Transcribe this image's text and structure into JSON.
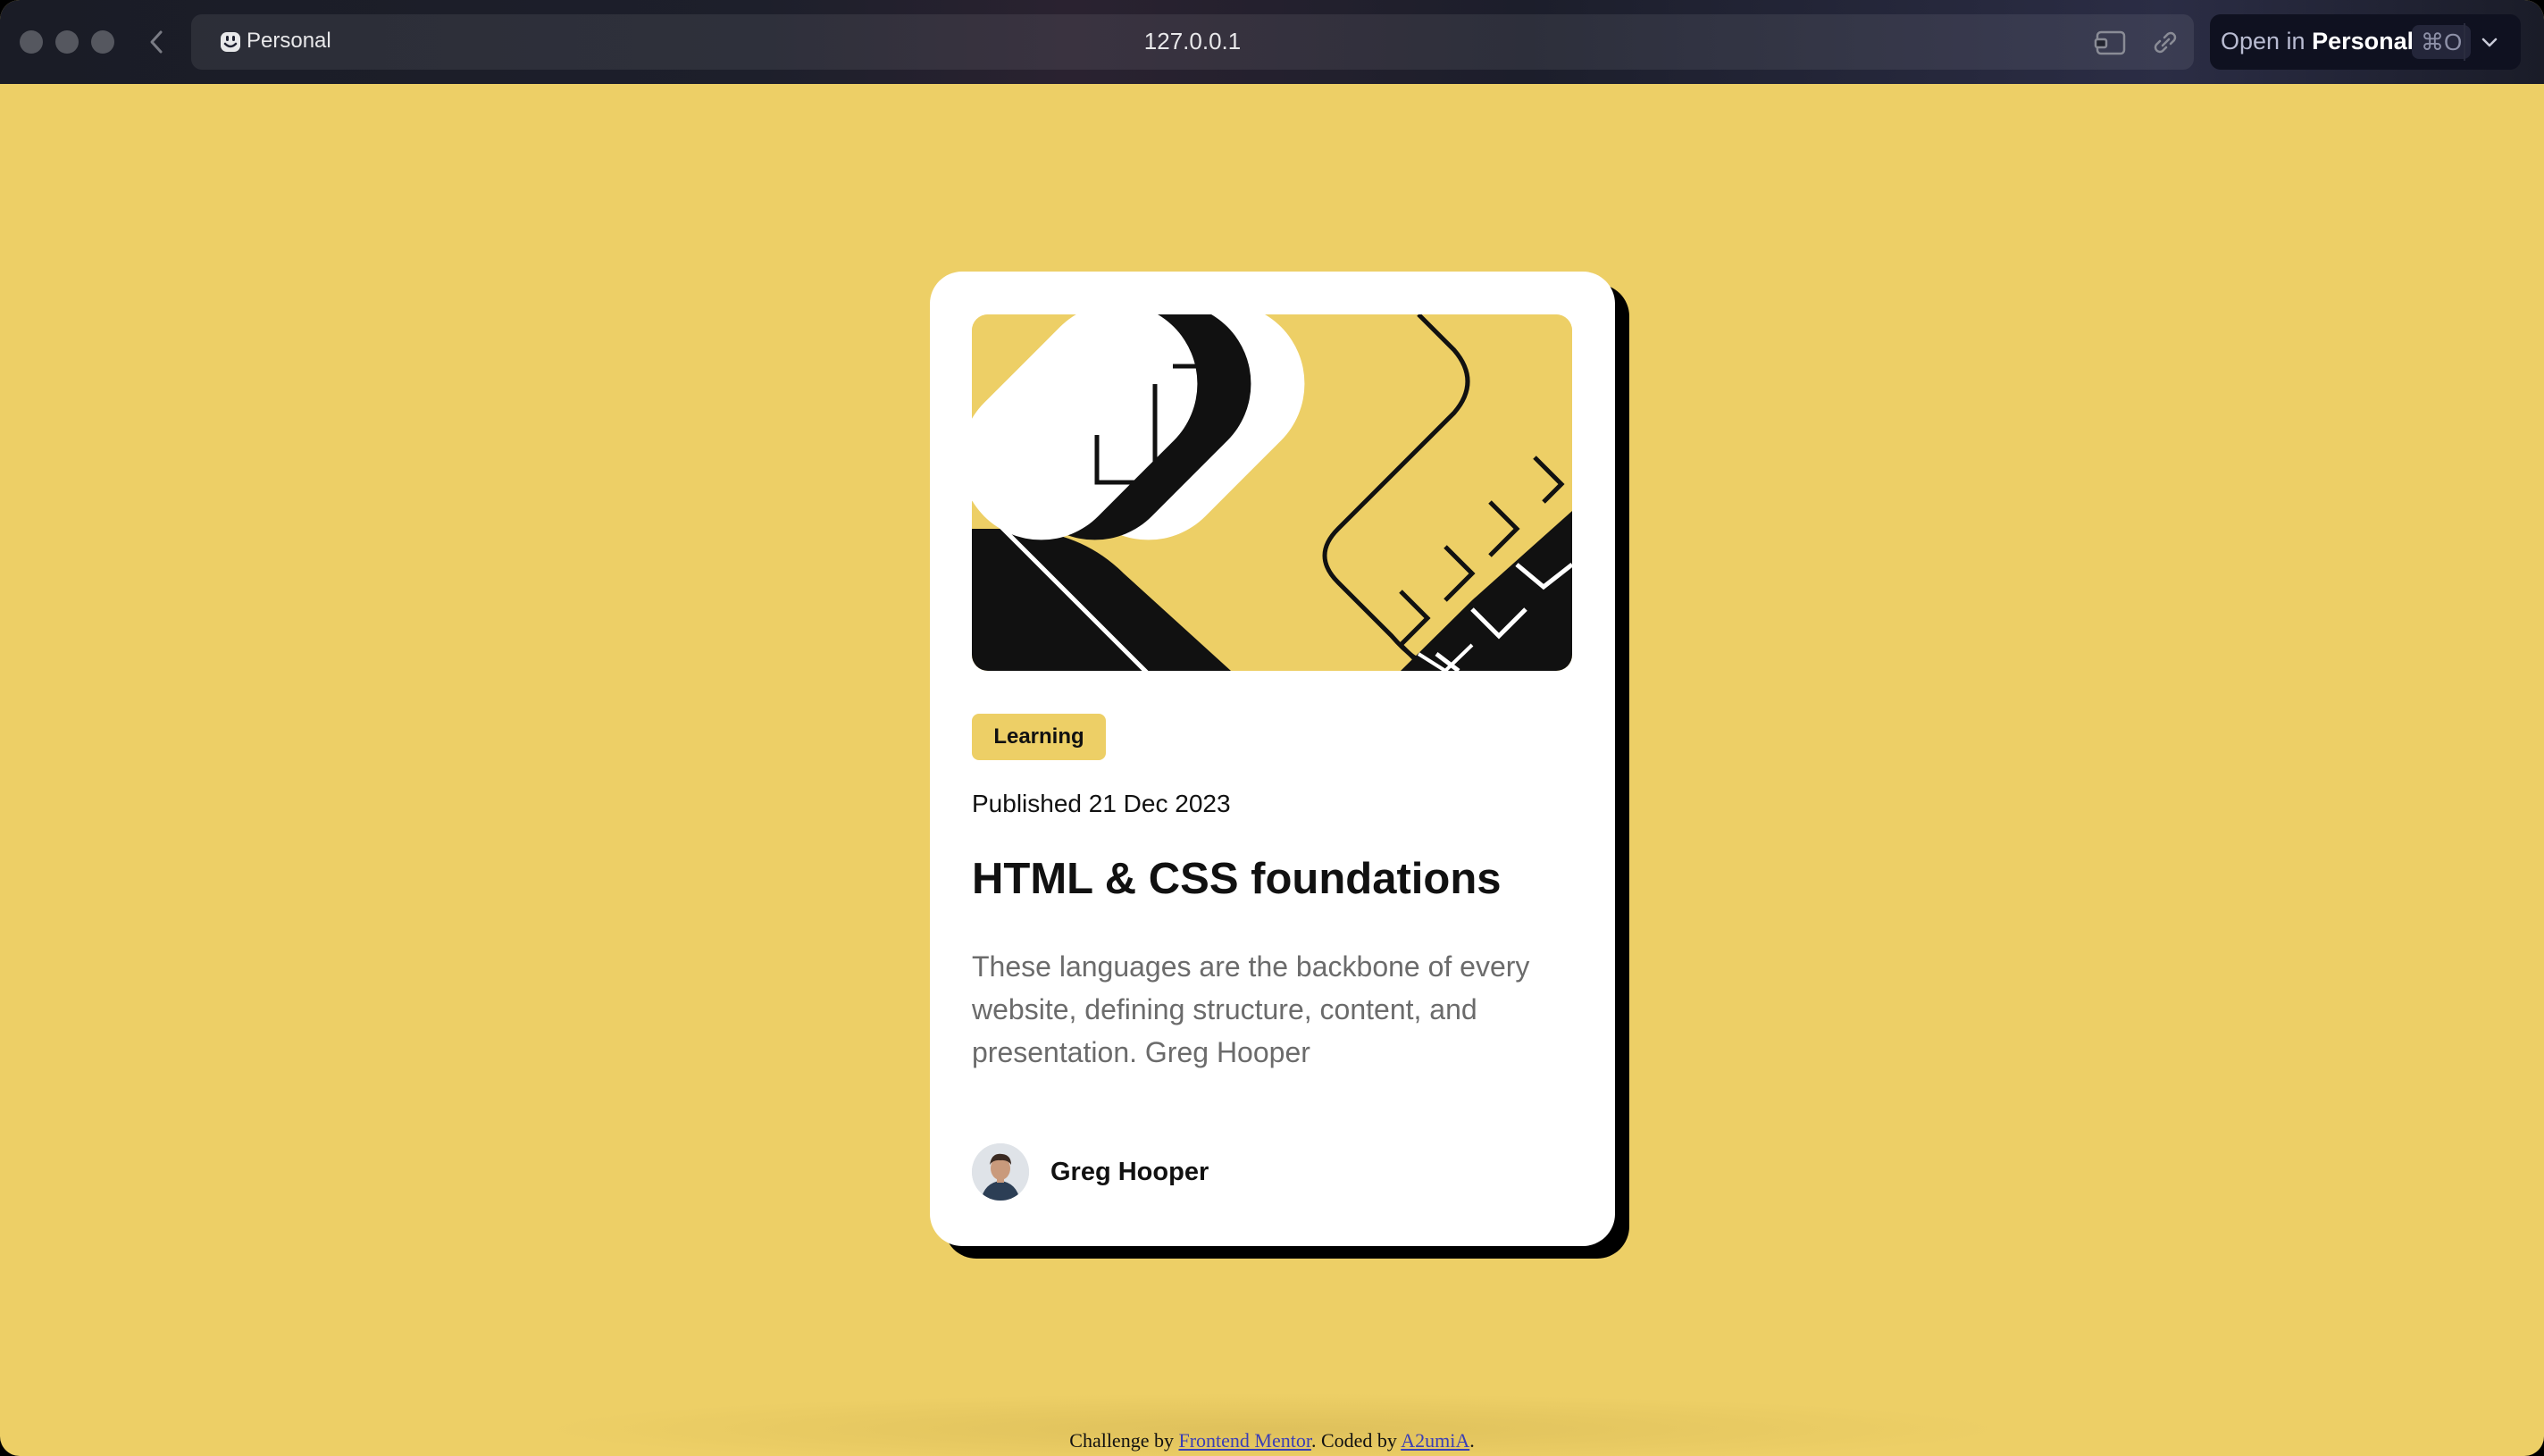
{
  "browser": {
    "profile_label": "Personal",
    "url": "127.0.0.1",
    "open_in_prefix": "Open in",
    "open_in_profile": "Personal",
    "open_shortcut": "⌘O"
  },
  "card": {
    "tag": "Learning",
    "published": "Published 21 Dec 2023",
    "title": "HTML & CSS foundations",
    "description": "These languages are the backbone of every website, defining structure, content, and presentation. Greg Hooper",
    "author": "Greg Hooper"
  },
  "footer": {
    "prefix": "Challenge by",
    "link1": "Frontend Mentor",
    "middle": ". Coded by",
    "link2": "A2umiA",
    "suffix": "."
  },
  "colors": {
    "background": "#EDCF66",
    "card": "#FFFFFF",
    "text": "#111111",
    "muted": "#6B6B6B",
    "link": "#3B3FB5"
  }
}
